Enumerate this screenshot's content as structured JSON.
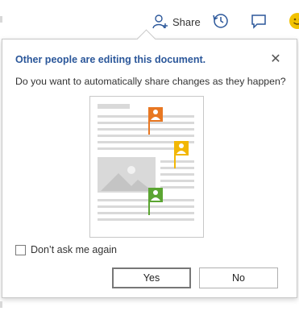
{
  "toolbar": {
    "share_label": "Share",
    "icons": [
      "share-person-icon",
      "history-icon",
      "comment-icon",
      "smiley-icon"
    ]
  },
  "dialog": {
    "title": "Other people are editing this document.",
    "message": "Do you want to automatically share changes as they happen?",
    "close_symbol": "✕",
    "checkbox_label": "Don’t ask me again",
    "checkbox_checked": false,
    "yes_label": "Yes",
    "no_label": "No"
  },
  "colors": {
    "title": "#2b579a",
    "flag_orange": "#e87722",
    "flag_yellow": "#f2b705",
    "flag_green": "#5ba532"
  }
}
